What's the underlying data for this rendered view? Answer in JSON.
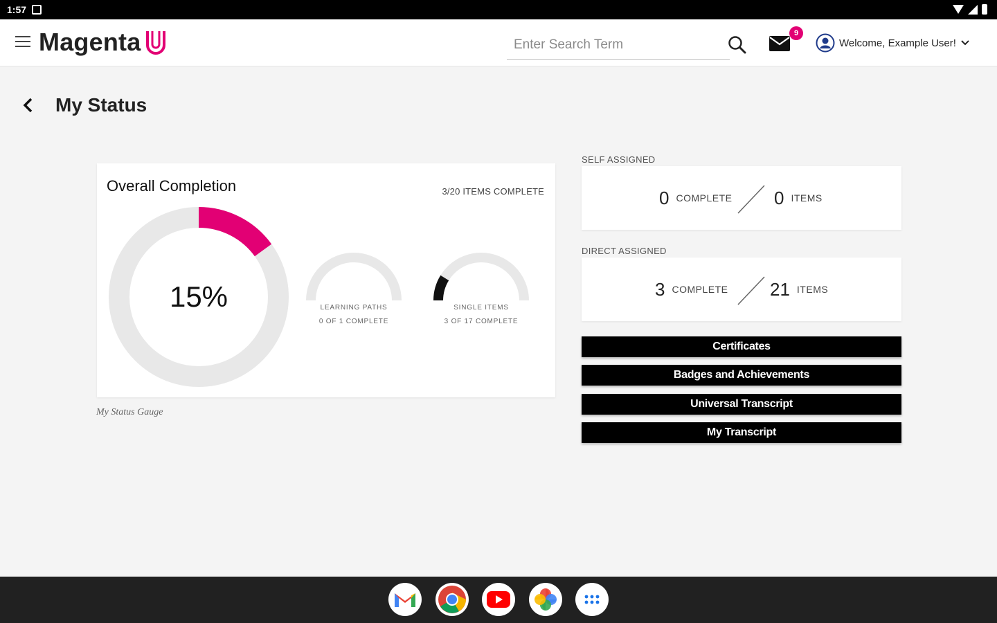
{
  "status_bar": {
    "time": "1:57"
  },
  "header": {
    "logo_text": "Magenta",
    "search_placeholder": "Enter Search Term",
    "mail_count": "9",
    "welcome": "Welcome, Example User!"
  },
  "page": {
    "title": "My Status"
  },
  "overall": {
    "title": "Overall Completion",
    "items_complete": "3/20 ITEMS COMPLETE",
    "percent_text": "15%",
    "percent_value": 0.15,
    "learning_paths": {
      "label": "LEARNING PATHS",
      "status": "0 OF 1 COMPLETE",
      "fraction": 0
    },
    "single_items": {
      "label": "SINGLE ITEMS",
      "status": "3 OF 17 COMPLETE",
      "fraction": 0.176
    },
    "caption": "My Status Gauge"
  },
  "self_assigned": {
    "label": "SELF ASSIGNED",
    "complete": "0",
    "complete_word": "COMPLETE",
    "items": "0",
    "items_word": "ITEMS"
  },
  "direct_assigned": {
    "label": "DIRECT ASSIGNED",
    "complete": "3",
    "complete_word": "COMPLETE",
    "items": "21",
    "items_word": "ITEMS"
  },
  "buttons": {
    "certificates": "Certificates",
    "badges": "Badges and Achievements",
    "universal_transcript": "Universal Transcript",
    "my_transcript": "My Transcript"
  },
  "colors": {
    "accent": "#e20074",
    "gauge_track": "#e8e8e8",
    "mini_fill": "#111111"
  },
  "dock_apps": [
    "gmail-icon",
    "chrome-icon",
    "youtube-icon",
    "photos-icon",
    "app-drawer-icon"
  ]
}
